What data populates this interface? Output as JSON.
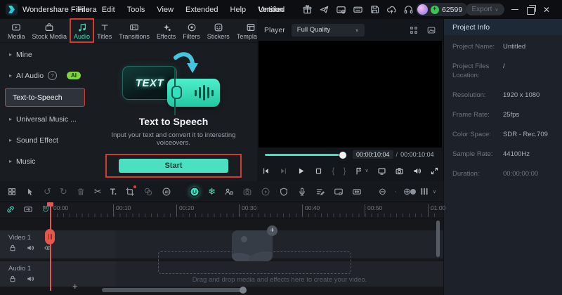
{
  "titlebar": {
    "app_name": "Wondershare Filmora",
    "menus": [
      "File",
      "Edit",
      "Tools",
      "View",
      "Extended",
      "Help",
      "Version"
    ],
    "document_title": "Untitled",
    "coin_count": "62599",
    "export_label": "Export",
    "export_chevron": "∨",
    "right_icon_names": [
      "gift-icon",
      "promo-plane-icon",
      "subscription-card-icon",
      "keyboard-icon",
      "save-icon",
      "cloud-upload-icon",
      "support-headset-icon",
      "apps-grid-icon",
      "avatar",
      "coin-icon"
    ]
  },
  "tabs": [
    {
      "label": "Media"
    },
    {
      "label": "Stock Media"
    },
    {
      "label": "Audio",
      "active": true
    },
    {
      "label": "Titles"
    },
    {
      "label": "Transitions"
    },
    {
      "label": "Effects"
    },
    {
      "label": "Filters"
    },
    {
      "label": "Stickers"
    },
    {
      "label": "Templates"
    }
  ],
  "sidebar": {
    "items": [
      {
        "label": "Mine",
        "chevron": "▸"
      },
      {
        "label": "AI Audio",
        "chevron": "▸",
        "help": "?",
        "badge": "AI"
      },
      {
        "label": "Text-to-Speech",
        "selected": true
      },
      {
        "label": "Universal Music ...",
        "chevron": "▸"
      },
      {
        "label": "Sound Effect",
        "chevron": "▸"
      },
      {
        "label": "Music",
        "chevron": "▸"
      }
    ]
  },
  "tts": {
    "graphic_label": "TEXT",
    "title": "Text to Speech",
    "description": "Input your text and convert it to interesting voiceovers.",
    "start_label": "Start"
  },
  "player": {
    "label": "Player",
    "quality": "Full Quality",
    "quality_chevron": "∨",
    "current_time": "00:00:10:04",
    "separator": "/",
    "total_time": "00:00:10:04",
    "progress_pct": 100
  },
  "project_info": {
    "title": "Project Info",
    "rows": [
      {
        "label": "Project Name:",
        "value": "Untitled"
      },
      {
        "label": "Project Files Location:",
        "value": "/"
      },
      {
        "label": "Resolution:",
        "value": "1920 x 1080"
      },
      {
        "label": "Frame Rate:",
        "value": "25fps"
      },
      {
        "label": "Color Space:",
        "value": "SDR - Rec.709"
      },
      {
        "label": "Sample Rate:",
        "value": "44100Hz"
      },
      {
        "label": "Duration:",
        "value": "00:00:00:00"
      }
    ]
  },
  "toolbar": {
    "left_icon_names": [
      "media-grid-icon",
      "select-cursor-icon",
      "undo-icon",
      "redo-icon",
      "delete-icon",
      "split-scissors-icon",
      "text-tool-icon",
      "crop-icon",
      "chroma-key-icon",
      "ai-tools-icon"
    ],
    "center_icon_names": [
      "avatar-mask-icon",
      "ai-effects-icon",
      "motion-track-icon",
      "camera-icon",
      "preview-render-icon",
      "mask-shield-icon",
      "record-voiceover-icon",
      "captions-icon",
      "keyframe-icon",
      "fit-timeline-icon"
    ],
    "undo_glyph": "↺",
    "redo_glyph": "↻",
    "scissors_glyph": "✂",
    "text_tool_glyph": "T.",
    "snowflake_glyph": "❄",
    "zoom_out_glyph": "⊖",
    "zoom_in_glyph": "⊕",
    "list_chevron": "∨"
  },
  "timeline": {
    "ruler": [
      "00:00",
      "00:10",
      "00:20",
      "00:30",
      "00:40",
      "00:50",
      "01:00"
    ],
    "tracks": [
      {
        "name": "Video 1"
      },
      {
        "name": "Audio 1"
      }
    ],
    "drop_hint": "Drag and drop media and effects here to create your video.",
    "add_track_label": "+",
    "placeholder_plus": "+"
  },
  "controls": {
    "brace_open": "{",
    "brace_close": "}",
    "mark_chevron": "∨"
  },
  "colors": {
    "accent_teal": "#3fe0bd",
    "annotation_red": "#d23b31",
    "playhead_red": "#e4574d",
    "ai_badge_green": "#7ed63e",
    "coin_green": "#3cc554",
    "panel_dark": "#15181d",
    "right_panel": "#1d2129"
  }
}
